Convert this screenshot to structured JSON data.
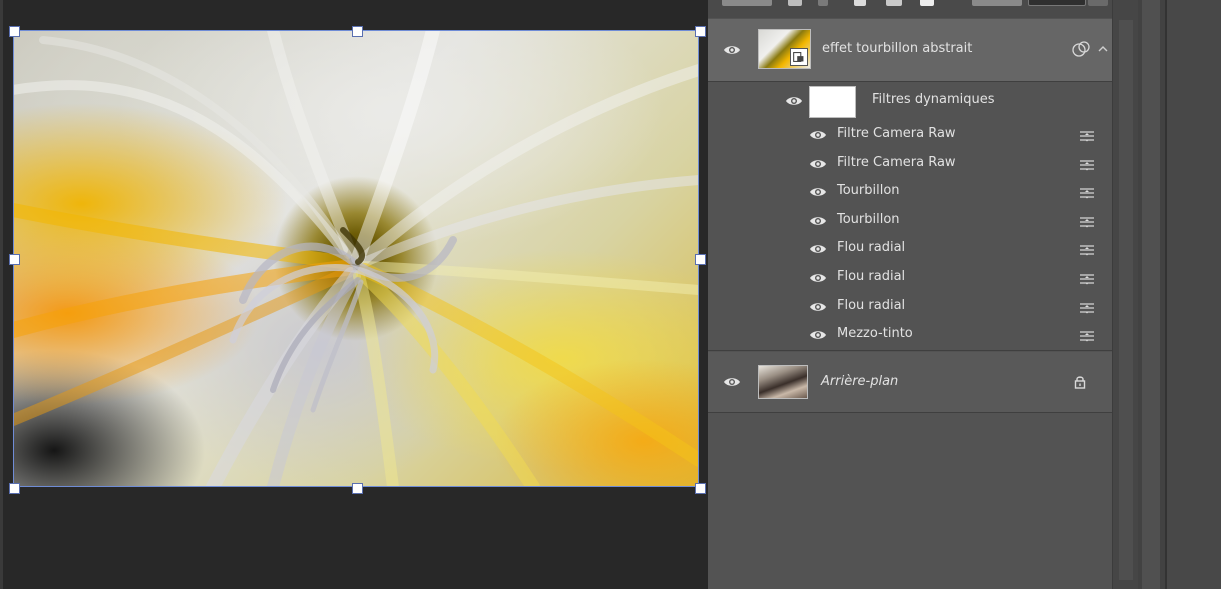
{
  "colors": {
    "panel_bg": "#535353",
    "selected_row": "#666666",
    "canvas_bg": "#282828",
    "selection_border": "#6f8cd6",
    "text": "#e2e2e2"
  },
  "layers": {
    "smart_object": {
      "name": "effet tourbillon abstrait",
      "visible": true,
      "icons": [
        "eye-icon",
        "smart-object-thumbnail",
        "linked-filter-icon",
        "collapse-chevron-icon"
      ],
      "smart_filters": {
        "label": "Filtres dynamiques",
        "visible": true,
        "items": [
          {
            "name": "Filtre Camera Raw"
          },
          {
            "name": "Filtre Camera Raw"
          },
          {
            "name": "Tourbillon"
          },
          {
            "name": "Tourbillon"
          },
          {
            "name": "Flou radial"
          },
          {
            "name": "Flou radial"
          },
          {
            "name": "Flou radial"
          },
          {
            "name": "Mezzo-tinto"
          }
        ]
      }
    },
    "background": {
      "name": "Arrière-plan",
      "visible": true,
      "locked": true,
      "icons": [
        "eye-icon",
        "photo-thumbnail",
        "lock-icon"
      ]
    }
  }
}
